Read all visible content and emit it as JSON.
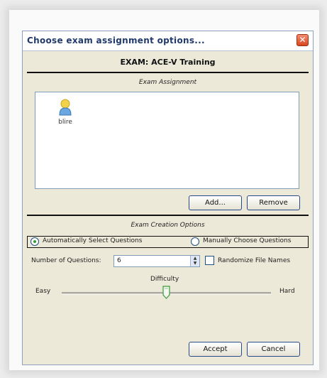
{
  "window": {
    "title": "Choose exam assignment options...",
    "close_glyph": "✕"
  },
  "exam": {
    "title": "EXAM: ACE-V Training"
  },
  "assignment": {
    "section_label": "Exam Assignment",
    "users": [
      {
        "name": "blire",
        "icon": "user-icon"
      }
    ],
    "add_label": "Add...",
    "remove_label": "Remove"
  },
  "creation": {
    "section_label": "Exam Creation Options",
    "options": [
      {
        "label": "Automatically Select Questions",
        "selected": true
      },
      {
        "label": "Manually Choose Questions",
        "selected": false
      }
    ],
    "num_questions_label": "Number of Questions:",
    "num_questions_value": "6",
    "randomize_label": "Randomize File Names",
    "randomize_checked": false,
    "difficulty_label": "Difficulty",
    "difficulty_min_label": "Easy",
    "difficulty_max_label": "Hard",
    "difficulty_level": 0.5
  },
  "footer": {
    "accept_label": "Accept",
    "cancel_label": "Cancel"
  },
  "colors": {
    "dialog_bg": "#ece9d8",
    "title_text": "#213a6b",
    "close_button": "#d8471f",
    "selected_radio": "#2fa12f"
  }
}
